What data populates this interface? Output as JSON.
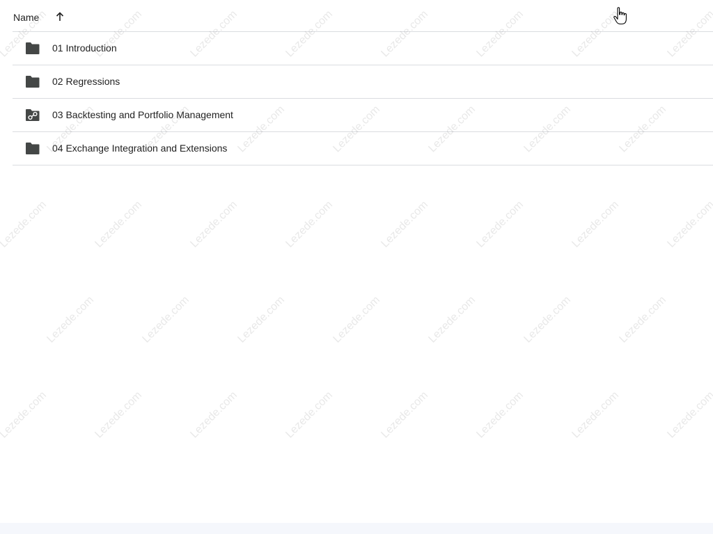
{
  "header": {
    "name_label": "Name",
    "sort_icon": "arrow-up-icon"
  },
  "files": [
    {
      "label": "01 Introduction",
      "icon": "folder-icon"
    },
    {
      "label": "02 Regressions",
      "icon": "folder-icon"
    },
    {
      "label": "03 Backtesting and Portfolio Management",
      "icon": "shared-folder-icon"
    },
    {
      "label": "04 Exchange Integration and Extensions",
      "icon": "folder-icon"
    }
  ],
  "watermark": "Lezede.com",
  "colors": {
    "divider": "#dadce0",
    "icon": "#444746",
    "text": "#1f1f1f",
    "bottom_strip": "#f5f7fc"
  },
  "cursor": "pointer-hand-icon"
}
